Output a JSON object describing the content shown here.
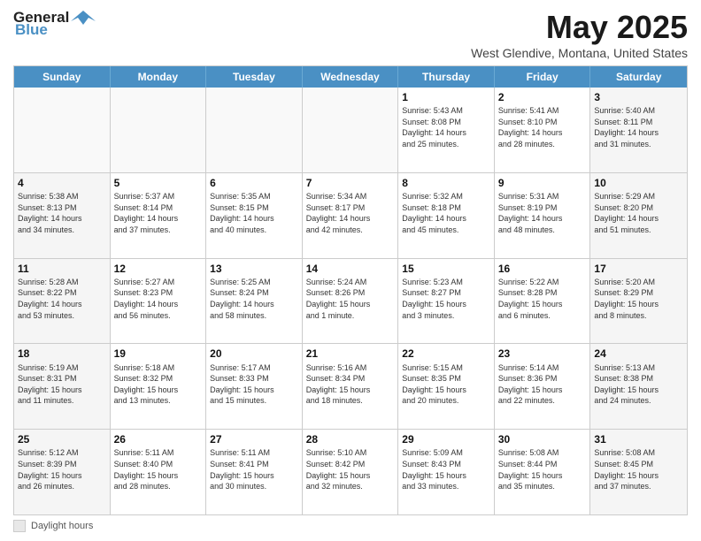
{
  "logo": {
    "line1": "General",
    "line2": "Blue"
  },
  "title": "May 2025",
  "location": "West Glendive, Montana, United States",
  "days_of_week": [
    "Sunday",
    "Monday",
    "Tuesday",
    "Wednesday",
    "Thursday",
    "Friday",
    "Saturday"
  ],
  "footer_label": "Daylight hours",
  "weeks": [
    [
      {
        "day": "",
        "info": ""
      },
      {
        "day": "",
        "info": ""
      },
      {
        "day": "",
        "info": ""
      },
      {
        "day": "",
        "info": ""
      },
      {
        "day": "1",
        "info": "Sunrise: 5:43 AM\nSunset: 8:08 PM\nDaylight: 14 hours\nand 25 minutes."
      },
      {
        "day": "2",
        "info": "Sunrise: 5:41 AM\nSunset: 8:10 PM\nDaylight: 14 hours\nand 28 minutes."
      },
      {
        "day": "3",
        "info": "Sunrise: 5:40 AM\nSunset: 8:11 PM\nDaylight: 14 hours\nand 31 minutes."
      }
    ],
    [
      {
        "day": "4",
        "info": "Sunrise: 5:38 AM\nSunset: 8:13 PM\nDaylight: 14 hours\nand 34 minutes."
      },
      {
        "day": "5",
        "info": "Sunrise: 5:37 AM\nSunset: 8:14 PM\nDaylight: 14 hours\nand 37 minutes."
      },
      {
        "day": "6",
        "info": "Sunrise: 5:35 AM\nSunset: 8:15 PM\nDaylight: 14 hours\nand 40 minutes."
      },
      {
        "day": "7",
        "info": "Sunrise: 5:34 AM\nSunset: 8:17 PM\nDaylight: 14 hours\nand 42 minutes."
      },
      {
        "day": "8",
        "info": "Sunrise: 5:32 AM\nSunset: 8:18 PM\nDaylight: 14 hours\nand 45 minutes."
      },
      {
        "day": "9",
        "info": "Sunrise: 5:31 AM\nSunset: 8:19 PM\nDaylight: 14 hours\nand 48 minutes."
      },
      {
        "day": "10",
        "info": "Sunrise: 5:29 AM\nSunset: 8:20 PM\nDaylight: 14 hours\nand 51 minutes."
      }
    ],
    [
      {
        "day": "11",
        "info": "Sunrise: 5:28 AM\nSunset: 8:22 PM\nDaylight: 14 hours\nand 53 minutes."
      },
      {
        "day": "12",
        "info": "Sunrise: 5:27 AM\nSunset: 8:23 PM\nDaylight: 14 hours\nand 56 minutes."
      },
      {
        "day": "13",
        "info": "Sunrise: 5:25 AM\nSunset: 8:24 PM\nDaylight: 14 hours\nand 58 minutes."
      },
      {
        "day": "14",
        "info": "Sunrise: 5:24 AM\nSunset: 8:26 PM\nDaylight: 15 hours\nand 1 minute."
      },
      {
        "day": "15",
        "info": "Sunrise: 5:23 AM\nSunset: 8:27 PM\nDaylight: 15 hours\nand 3 minutes."
      },
      {
        "day": "16",
        "info": "Sunrise: 5:22 AM\nSunset: 8:28 PM\nDaylight: 15 hours\nand 6 minutes."
      },
      {
        "day": "17",
        "info": "Sunrise: 5:20 AM\nSunset: 8:29 PM\nDaylight: 15 hours\nand 8 minutes."
      }
    ],
    [
      {
        "day": "18",
        "info": "Sunrise: 5:19 AM\nSunset: 8:31 PM\nDaylight: 15 hours\nand 11 minutes."
      },
      {
        "day": "19",
        "info": "Sunrise: 5:18 AM\nSunset: 8:32 PM\nDaylight: 15 hours\nand 13 minutes."
      },
      {
        "day": "20",
        "info": "Sunrise: 5:17 AM\nSunset: 8:33 PM\nDaylight: 15 hours\nand 15 minutes."
      },
      {
        "day": "21",
        "info": "Sunrise: 5:16 AM\nSunset: 8:34 PM\nDaylight: 15 hours\nand 18 minutes."
      },
      {
        "day": "22",
        "info": "Sunrise: 5:15 AM\nSunset: 8:35 PM\nDaylight: 15 hours\nand 20 minutes."
      },
      {
        "day": "23",
        "info": "Sunrise: 5:14 AM\nSunset: 8:36 PM\nDaylight: 15 hours\nand 22 minutes."
      },
      {
        "day": "24",
        "info": "Sunrise: 5:13 AM\nSunset: 8:38 PM\nDaylight: 15 hours\nand 24 minutes."
      }
    ],
    [
      {
        "day": "25",
        "info": "Sunrise: 5:12 AM\nSunset: 8:39 PM\nDaylight: 15 hours\nand 26 minutes."
      },
      {
        "day": "26",
        "info": "Sunrise: 5:11 AM\nSunset: 8:40 PM\nDaylight: 15 hours\nand 28 minutes."
      },
      {
        "day": "27",
        "info": "Sunrise: 5:11 AM\nSunset: 8:41 PM\nDaylight: 15 hours\nand 30 minutes."
      },
      {
        "day": "28",
        "info": "Sunrise: 5:10 AM\nSunset: 8:42 PM\nDaylight: 15 hours\nand 32 minutes."
      },
      {
        "day": "29",
        "info": "Sunrise: 5:09 AM\nSunset: 8:43 PM\nDaylight: 15 hours\nand 33 minutes."
      },
      {
        "day": "30",
        "info": "Sunrise: 5:08 AM\nSunset: 8:44 PM\nDaylight: 15 hours\nand 35 minutes."
      },
      {
        "day": "31",
        "info": "Sunrise: 5:08 AM\nSunset: 8:45 PM\nDaylight: 15 hours\nand 37 minutes."
      }
    ]
  ]
}
